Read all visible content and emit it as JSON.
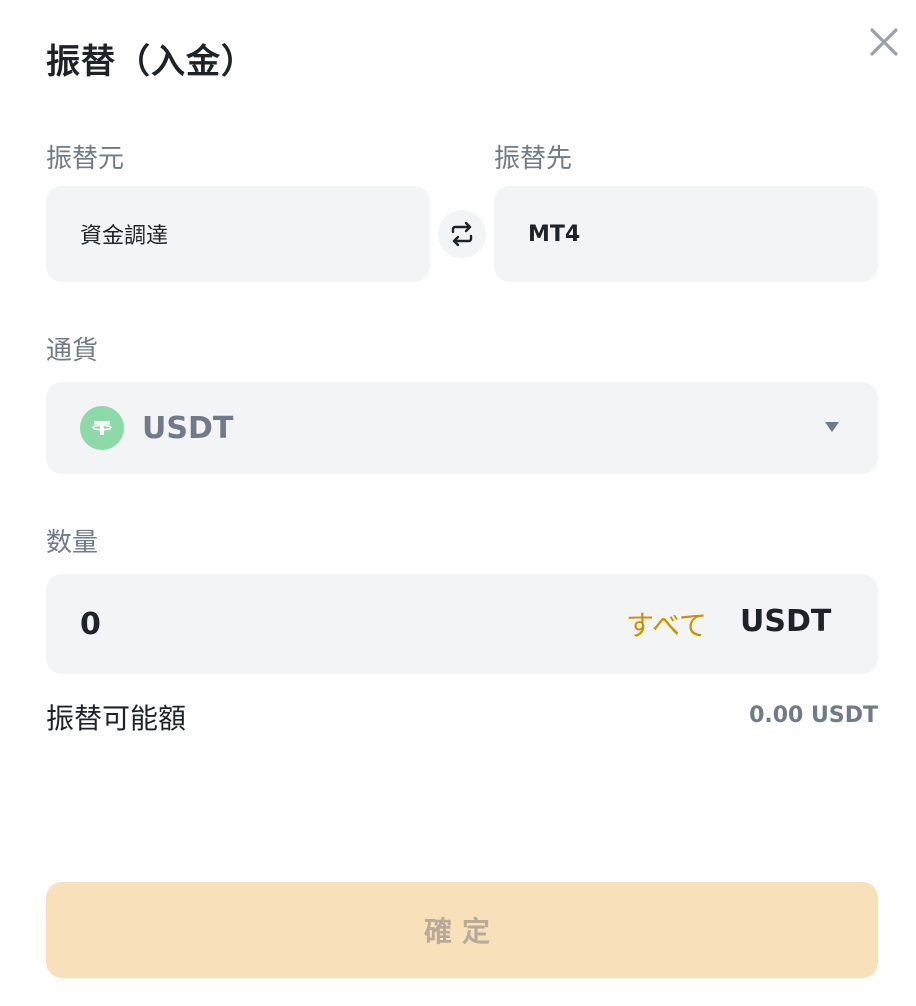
{
  "modal": {
    "title": "振替（入金）",
    "from": {
      "label": "振替元",
      "value": "資金調達"
    },
    "to": {
      "label": "振替先",
      "value": "MT4"
    },
    "currency": {
      "label": "通貨",
      "selected": "USDT",
      "icon": "tether-icon",
      "icon_glyph": "T"
    },
    "amount": {
      "label": "数量",
      "value": "0",
      "all_label": "すべて",
      "unit": "USDT"
    },
    "available": {
      "label": "振替可能額",
      "value": "0.00 USDT"
    },
    "confirm_label": "確定"
  },
  "colors": {
    "accent": "#c99400",
    "field_bg": "#f3f4f6",
    "confirm_bg_disabled": "#f8e0bb",
    "tether_green": "#8ed9a8",
    "muted_text": "#707a8a"
  }
}
